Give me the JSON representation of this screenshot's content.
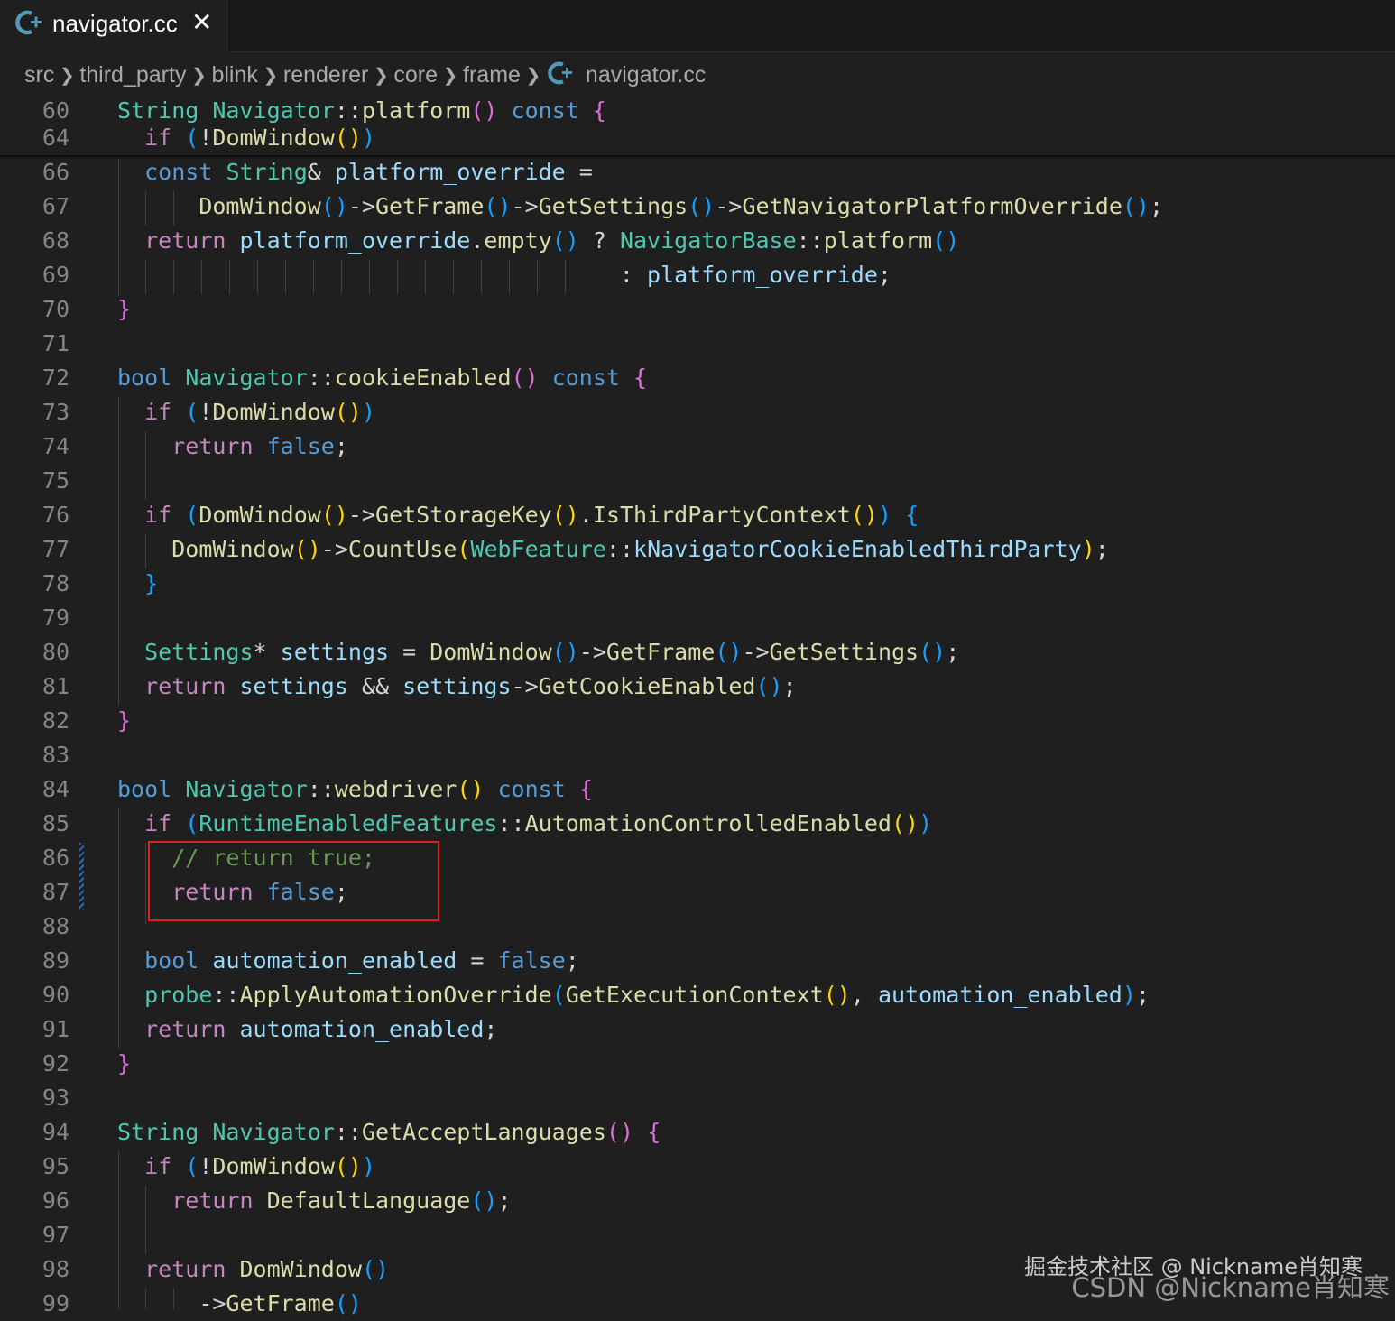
{
  "tab": {
    "icon": "cpp-icon",
    "title": "navigator.cc",
    "close_glyph": "✕"
  },
  "breadcrumb": [
    "src",
    "third_party",
    "blink",
    "renderer",
    "core",
    "frame",
    "navigator.cc"
  ],
  "watermark": {
    "line1": "掘金技术社区 @ Nickname肖知寒",
    "line2": "CSDN @Nickname肖知寒"
  },
  "colors": {
    "keyword": "#569cd6",
    "control": "#c586c0",
    "type": "#4ec9b0",
    "function": "#dcdcaa",
    "variable": "#9cdcfe",
    "comment": "#6a9955",
    "highlight_box": "#e02020"
  },
  "code_lines": [
    {
      "n": "60",
      "sticky": true,
      "tokens": [
        [
          "String",
          "ty"
        ],
        [
          " ",
          "pl"
        ],
        [
          "Navigator",
          "ty"
        ],
        [
          "::",
          "pl"
        ],
        [
          "platform",
          "fn"
        ],
        [
          "()",
          "b2"
        ],
        [
          " ",
          "pl"
        ],
        [
          "const",
          "kw"
        ],
        [
          " ",
          "pl"
        ],
        [
          "{",
          "b2"
        ]
      ]
    },
    {
      "n": "64",
      "sticky": true,
      "tokens": [
        [
          "  ",
          "pl"
        ],
        [
          "if",
          "ctl"
        ],
        [
          " ",
          "pl"
        ],
        [
          "(",
          "b3"
        ],
        [
          "!",
          "pl"
        ],
        [
          "DomWindow",
          "fn"
        ],
        [
          "()",
          "b1"
        ],
        [
          ")",
          "b3"
        ]
      ]
    },
    {
      "n": "66",
      "tokens": [
        [
          "  ",
          "pl"
        ],
        [
          "const",
          "kw"
        ],
        [
          " ",
          "pl"
        ],
        [
          "String",
          "ty"
        ],
        [
          "& ",
          "pl"
        ],
        [
          "platform_override",
          "var"
        ],
        [
          " =",
          "pl"
        ]
      ]
    },
    {
      "n": "67",
      "tokens": [
        [
          "      ",
          "pl"
        ],
        [
          "DomWindow",
          "fn"
        ],
        [
          "()",
          "b3"
        ],
        [
          "->",
          "pl"
        ],
        [
          "GetFrame",
          "fn"
        ],
        [
          "()",
          "b3"
        ],
        [
          "->",
          "pl"
        ],
        [
          "GetSettings",
          "fn"
        ],
        [
          "()",
          "b3"
        ],
        [
          "->",
          "pl"
        ],
        [
          "GetNavigatorPlatformOverride",
          "fn"
        ],
        [
          "()",
          "b3"
        ],
        [
          ";",
          "pl"
        ]
      ]
    },
    {
      "n": "68",
      "tokens": [
        [
          "  ",
          "pl"
        ],
        [
          "return",
          "ctl"
        ],
        [
          " ",
          "pl"
        ],
        [
          "platform_override",
          "var"
        ],
        [
          ".",
          "pl"
        ],
        [
          "empty",
          "fn"
        ],
        [
          "()",
          "b3"
        ],
        [
          " ? ",
          "pl"
        ],
        [
          "NavigatorBase",
          "ty"
        ],
        [
          "::",
          "pl"
        ],
        [
          "platform",
          "fn"
        ],
        [
          "()",
          "b3"
        ]
      ]
    },
    {
      "n": "69",
      "tokens": [
        [
          "                                     : ",
          "pl"
        ],
        [
          "platform_override",
          "var"
        ],
        [
          ";",
          "pl"
        ]
      ]
    },
    {
      "n": "70",
      "tokens": [
        [
          "}",
          "b2"
        ]
      ]
    },
    {
      "n": "71",
      "tokens": []
    },
    {
      "n": "72",
      "tokens": [
        [
          "bool",
          "kw"
        ],
        [
          " ",
          "pl"
        ],
        [
          "Navigator",
          "ty"
        ],
        [
          "::",
          "pl"
        ],
        [
          "cookieEnabled",
          "fn"
        ],
        [
          "()",
          "b2"
        ],
        [
          " ",
          "pl"
        ],
        [
          "const",
          "kw"
        ],
        [
          " ",
          "pl"
        ],
        [
          "{",
          "b2"
        ]
      ]
    },
    {
      "n": "73",
      "tokens": [
        [
          "  ",
          "pl"
        ],
        [
          "if",
          "ctl"
        ],
        [
          " ",
          "pl"
        ],
        [
          "(",
          "b3"
        ],
        [
          "!",
          "pl"
        ],
        [
          "DomWindow",
          "fn"
        ],
        [
          "()",
          "b1"
        ],
        [
          ")",
          "b3"
        ]
      ]
    },
    {
      "n": "74",
      "tokens": [
        [
          "    ",
          "pl"
        ],
        [
          "return",
          "ctl"
        ],
        [
          " ",
          "pl"
        ],
        [
          "false",
          "kw"
        ],
        [
          ";",
          "pl"
        ]
      ]
    },
    {
      "n": "75",
      "tokens": []
    },
    {
      "n": "76",
      "tokens": [
        [
          "  ",
          "pl"
        ],
        [
          "if",
          "ctl"
        ],
        [
          " ",
          "pl"
        ],
        [
          "(",
          "b3"
        ],
        [
          "DomWindow",
          "fn"
        ],
        [
          "()",
          "b1"
        ],
        [
          "->",
          "pl"
        ],
        [
          "GetStorageKey",
          "fn"
        ],
        [
          "()",
          "b1"
        ],
        [
          ".",
          "pl"
        ],
        [
          "IsThirdPartyContext",
          "fn"
        ],
        [
          "()",
          "b1"
        ],
        [
          ")",
          "b3"
        ],
        [
          " ",
          "pl"
        ],
        [
          "{",
          "b3"
        ]
      ]
    },
    {
      "n": "77",
      "tokens": [
        [
          "    ",
          "pl"
        ],
        [
          "DomWindow",
          "fn"
        ],
        [
          "()",
          "b1"
        ],
        [
          "->",
          "pl"
        ],
        [
          "CountUse",
          "fn"
        ],
        [
          "(",
          "b1"
        ],
        [
          "WebFeature",
          "ty"
        ],
        [
          "::",
          "pl"
        ],
        [
          "kNavigatorCookieEnabledThirdParty",
          "var"
        ],
        [
          ")",
          "b1"
        ],
        [
          ";",
          "pl"
        ]
      ]
    },
    {
      "n": "78",
      "tokens": [
        [
          "  ",
          "pl"
        ],
        [
          "}",
          "b3"
        ]
      ]
    },
    {
      "n": "79",
      "tokens": []
    },
    {
      "n": "80",
      "tokens": [
        [
          "  ",
          "pl"
        ],
        [
          "Settings",
          "ty"
        ],
        [
          "* ",
          "pl"
        ],
        [
          "settings",
          "var"
        ],
        [
          " = ",
          "pl"
        ],
        [
          "DomWindow",
          "fn"
        ],
        [
          "()",
          "b3"
        ],
        [
          "->",
          "pl"
        ],
        [
          "GetFrame",
          "fn"
        ],
        [
          "()",
          "b3"
        ],
        [
          "->",
          "pl"
        ],
        [
          "GetSettings",
          "fn"
        ],
        [
          "()",
          "b3"
        ],
        [
          ";",
          "pl"
        ]
      ]
    },
    {
      "n": "81",
      "tokens": [
        [
          "  ",
          "pl"
        ],
        [
          "return",
          "ctl"
        ],
        [
          " ",
          "pl"
        ],
        [
          "settings",
          "var"
        ],
        [
          " && ",
          "pl"
        ],
        [
          "settings",
          "var"
        ],
        [
          "->",
          "pl"
        ],
        [
          "GetCookieEnabled",
          "fn"
        ],
        [
          "()",
          "b3"
        ],
        [
          ";",
          "pl"
        ]
      ]
    },
    {
      "n": "82",
      "tokens": [
        [
          "}",
          "b2"
        ]
      ]
    },
    {
      "n": "83",
      "tokens": []
    },
    {
      "n": "84",
      "tokens": [
        [
          "bool",
          "kw"
        ],
        [
          " ",
          "pl"
        ],
        [
          "Navigator",
          "ty"
        ],
        [
          "::",
          "pl"
        ],
        [
          "webdriver",
          "fn"
        ],
        [
          "()",
          "b1"
        ],
        [
          " ",
          "pl"
        ],
        [
          "const",
          "kw"
        ],
        [
          " ",
          "pl"
        ],
        [
          "{",
          "b2"
        ]
      ]
    },
    {
      "n": "85",
      "tokens": [
        [
          "  ",
          "pl"
        ],
        [
          "if",
          "ctl"
        ],
        [
          " ",
          "pl"
        ],
        [
          "(",
          "b3"
        ],
        [
          "RuntimeEnabledFeatures",
          "ty"
        ],
        [
          "::",
          "pl"
        ],
        [
          "AutomationControlledEnabled",
          "fn"
        ],
        [
          "()",
          "b1"
        ],
        [
          ")",
          "b3"
        ]
      ]
    },
    {
      "n": "86",
      "tokens": [
        [
          "    ",
          "pl"
        ],
        [
          "// return true;",
          "cm"
        ]
      ]
    },
    {
      "n": "87",
      "tokens": [
        [
          "    ",
          "pl"
        ],
        [
          "return",
          "ctl"
        ],
        [
          " ",
          "pl"
        ],
        [
          "false",
          "kw"
        ],
        [
          ";",
          "pl"
        ]
      ]
    },
    {
      "n": "88",
      "tokens": []
    },
    {
      "n": "89",
      "tokens": [
        [
          "  ",
          "pl"
        ],
        [
          "bool",
          "kw"
        ],
        [
          " ",
          "pl"
        ],
        [
          "automation_enabled",
          "var"
        ],
        [
          " = ",
          "pl"
        ],
        [
          "false",
          "kw"
        ],
        [
          ";",
          "pl"
        ]
      ]
    },
    {
      "n": "90",
      "tokens": [
        [
          "  ",
          "pl"
        ],
        [
          "probe",
          "ty"
        ],
        [
          "::",
          "pl"
        ],
        [
          "ApplyAutomationOverride",
          "fn"
        ],
        [
          "(",
          "b3"
        ],
        [
          "GetExecutionContext",
          "fn"
        ],
        [
          "()",
          "b1"
        ],
        [
          ", ",
          "pl"
        ],
        [
          "automation_enabled",
          "var"
        ],
        [
          ")",
          "b3"
        ],
        [
          ";",
          "pl"
        ]
      ]
    },
    {
      "n": "91",
      "tokens": [
        [
          "  ",
          "pl"
        ],
        [
          "return",
          "ctl"
        ],
        [
          " ",
          "pl"
        ],
        [
          "automation_enabled",
          "var"
        ],
        [
          ";",
          "pl"
        ]
      ]
    },
    {
      "n": "92",
      "tokens": [
        [
          "}",
          "b2"
        ]
      ]
    },
    {
      "n": "93",
      "tokens": []
    },
    {
      "n": "94",
      "tokens": [
        [
          "String",
          "ty"
        ],
        [
          " ",
          "pl"
        ],
        [
          "Navigator",
          "ty"
        ],
        [
          "::",
          "pl"
        ],
        [
          "GetAcceptLanguages",
          "fn"
        ],
        [
          "()",
          "b2"
        ],
        [
          " ",
          "pl"
        ],
        [
          "{",
          "b2"
        ]
      ]
    },
    {
      "n": "95",
      "tokens": [
        [
          "  ",
          "pl"
        ],
        [
          "if",
          "ctl"
        ],
        [
          " ",
          "pl"
        ],
        [
          "(",
          "b3"
        ],
        [
          "!",
          "pl"
        ],
        [
          "DomWindow",
          "fn"
        ],
        [
          "()",
          "b1"
        ],
        [
          ")",
          "b3"
        ]
      ]
    },
    {
      "n": "96",
      "tokens": [
        [
          "    ",
          "pl"
        ],
        [
          "return",
          "ctl"
        ],
        [
          " ",
          "pl"
        ],
        [
          "DefaultLanguage",
          "fn"
        ],
        [
          "()",
          "b3"
        ],
        [
          ";",
          "pl"
        ]
      ]
    },
    {
      "n": "97",
      "tokens": []
    },
    {
      "n": "98",
      "tokens": [
        [
          "  ",
          "pl"
        ],
        [
          "return",
          "ctl"
        ],
        [
          " ",
          "pl"
        ],
        [
          "DomWindow",
          "fn"
        ],
        [
          "()",
          "b3"
        ]
      ]
    },
    {
      "n": "99",
      "tokens": [
        [
          "      ",
          "pl"
        ],
        [
          "->",
          "pl"
        ],
        [
          "GetFrame",
          "fn"
        ],
        [
          "()",
          "b3"
        ]
      ]
    }
  ]
}
